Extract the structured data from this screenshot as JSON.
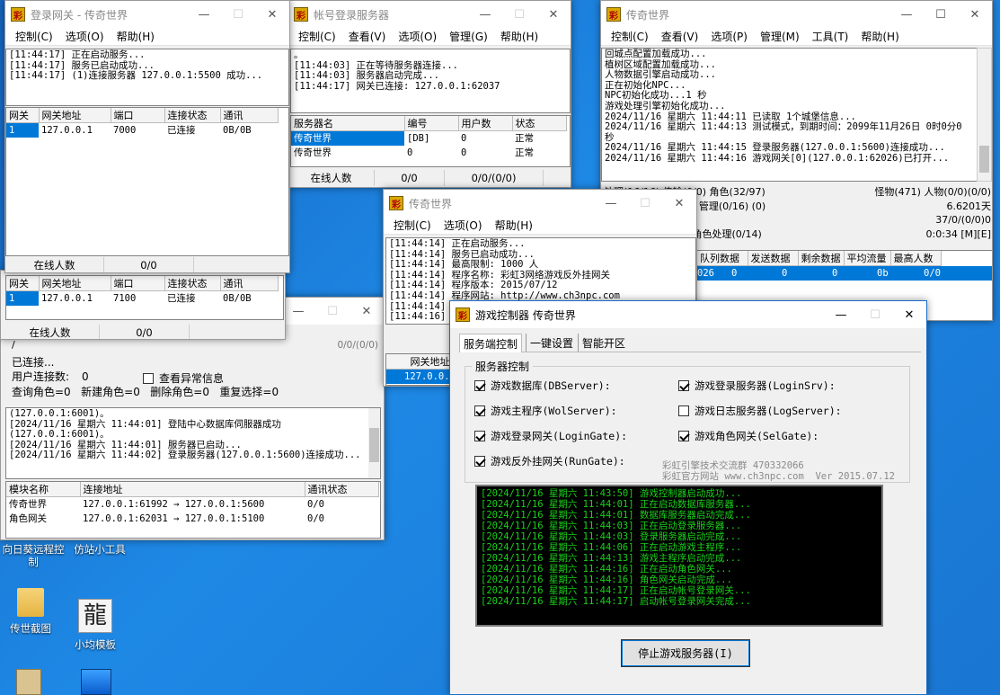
{
  "desktop": {
    "icons": [
      {
        "label": "向日葵远程控制"
      },
      {
        "label": "仿站小工具"
      },
      {
        "label": "传世截图"
      },
      {
        "label": "小均模板"
      }
    ]
  },
  "w_gate": {
    "title": "登录网关 - 传奇世界",
    "menu": [
      "控制(C)",
      "选项(O)",
      "帮助(H)"
    ],
    "log": "[11:44:17] 正在启动服务...\n[11:44:17] 服务已启动成功...\n[11:44:17] (1)连接服务器 127.0.0.1:5500 成功...",
    "headers": [
      "网关",
      "网关地址",
      "端口",
      "连接状态",
      "通讯"
    ],
    "rows": [
      [
        "1",
        "127.0.0.1",
        "7000",
        "已连接",
        "0B/0B"
      ]
    ],
    "status": [
      "在线人数",
      "0/0"
    ]
  },
  "w_sel": {
    "headers": [
      "网关",
      "网关地址",
      "端口",
      "连接状态",
      "通讯"
    ],
    "rows": [
      [
        "1",
        "127.0.0.1",
        "7100",
        "已连接",
        "0B/0B"
      ]
    ],
    "status": [
      "在线人数",
      "0/0"
    ]
  },
  "w_db": {
    "ratio": "0/0/(0/0)",
    "line1": "已连接...",
    "conn_label": "用户连接数:",
    "conn_value": "0",
    "check_label": "查看异常信息",
    "stats": "查询角色=0   新建角色=0   删除角色=0   重复选择=0",
    "log": "(127.0.0.1:6001)。\n[2024/11/16 星期六 11:44:01] 登陆中心数据库伺服器成功\n(127.0.0.1:6001)。\n[2024/11/16 星期六 11:44:01] 服务器已启动...\n[2024/11/16 星期六 11:44:02] 登录服务器(127.0.0.1:5600)连接成功...",
    "headers": [
      "模块名称",
      "连接地址",
      "通讯状态"
    ],
    "rows": [
      [
        "传奇世界",
        "127.0.0.1:61992 → 127.0.0.1:5600",
        "0/0"
      ],
      [
        "角色网关",
        "127.0.0.1:62031 → 127.0.0.1:5100",
        "0/0"
      ]
    ]
  },
  "w_login": {
    "title": "帐号登录服务器",
    "menu": [
      "控制(C)",
      "查看(V)",
      "选项(O)",
      "管理(G)",
      "帮助(H)"
    ],
    "log": "。\n[11:44:03] 正在等待服务器连接...\n[11:44:03] 服务器启动完成...\n[11:44:17] 网关已连接: 127.0.0.1:62037",
    "headers": [
      "服务器名",
      "编号",
      "用户数",
      "状态"
    ],
    "rows": [
      [
        "传奇世界",
        "[DB]",
        "0",
        "正常"
      ],
      [
        "传奇世界",
        "0",
        "0",
        "正常"
      ]
    ],
    "status": [
      "在线人数",
      "0/0",
      "0/0/(0/0)"
    ]
  },
  "w_main": {
    "title": "传奇世界",
    "menu": [
      "控制(C)",
      "查看(V)",
      "选项(P)",
      "管理(M)",
      "工具(T)",
      "帮助(H)"
    ],
    "log": "回城点配置加载成功...\n植树区域配置加载成功...\n人物数据引擎启动成功...\n正在初始化NPC...\nNPC初始化成功...1 秒\n游戏处理引擎初始化成功...\n2024/11/16 星期六 11:44:11 已读取 1个城堡信息...\n2024/11/16 星期六 11:44:13 测试模式，到期时间：2099年11月26日 0时0分0\n秒\n2024/11/16 星期六 11:44:15 登录服务器(127.0.0.1:5600)连接成功...\n2024/11/16 星期六 11:44:16 游戏网关[0](127.0.0.1:62026)已打开...",
    "st1": "处理(16/16) 传输(0/0) 角色(32/97)",
    "st1r": "怪物(471)   人物(0/0)(0/0)",
    "st2": "(2863) 交易(32/63) 管理(0/16) (0)",
    "st2r": "6.6201天",
    "st3r": "37/0/(0/0)0",
    "st4": "处理怪物(0/16/16) 角色处理(0/14)",
    "st4r": "0:0:34 [M][E]",
    "headers": [
      "队列数据",
      "发送数据",
      "剩余数据",
      "平均流量",
      "最高人数"
    ],
    "row": [
      "026",
      "0",
      "0",
      "0",
      "0b",
      "0/0"
    ]
  },
  "w_run": {
    "title": "传奇世界",
    "menu": [
      "控制(C)",
      "选项(O)",
      "帮助(H)"
    ],
    "log": "[11:44:14] 正在启动服务...\n[11:44:14] 服务已启动成功...\n[11:44:14] 最高限制: 1000 人\n[11:44:14] 程序名称: 彩虹3网络游戏反外挂网关\n[11:44:14] 程序版本: 2015/07/12\n[11:44:14] 程序网站: http://www.ch3npc.com\n[11:44:14] 程\n[11:44:16] (",
    "headers": [
      "网关地址"
    ],
    "row": "127.0.0."
  },
  "w_ctrl": {
    "title": "游戏控制器  传奇世界",
    "tabs": [
      "服务端控制",
      "一键设置",
      "智能开区"
    ],
    "group": "服务器控制",
    "checks": [
      {
        "label": "游戏数据库(DBServer):",
        "on": true
      },
      {
        "label": "游戏登录服务器(LoginSrv):",
        "on": true
      },
      {
        "label": "游戏主程序(WolServer):",
        "on": true
      },
      {
        "label": "游戏日志服务器(LogServer):",
        "on": false
      },
      {
        "label": "游戏登录网关(LoginGate):",
        "on": true
      },
      {
        "label": "游戏角色网关(SelGate):",
        "on": true
      },
      {
        "label": "游戏反外挂网关(RunGate):",
        "on": true
      }
    ],
    "credit1": "彩虹引擎技术交流群 470332066",
    "credit2": "彩虹官方网站 www.ch3npc.com  Ver 2015.07.12",
    "log": "[2024/11/16 星期六 11:43:50] 游戏控制器启动成功...\n[2024/11/16 星期六 11:44:01] 正在启动数据库服务器...\n[2024/11/16 星期六 11:44:01] 数据库服务器启动完成...\n[2024/11/16 星期六 11:44:03] 正在启动登录服务器...\n[2024/11/16 星期六 11:44:03] 登录服务器启动完成...\n[2024/11/16 星期六 11:44:06] 正在启动游戏主程序...\n[2024/11/16 星期六 11:44:13] 游戏主程序启动完成...\n[2024/11/16 星期六 11:44:16] 正在启动角色网关...\n[2024/11/16 星期六 11:44:16] 角色网关启动完成...\n[2024/11/16 星期六 11:44:17] 正在启动帐号登录网关...\n[2024/11/16 星期六 11:44:17] 启动帐号登录网关完成...",
    "stop_button": "停止游戏服务器(I)",
    "log_color": "#19d119"
  }
}
